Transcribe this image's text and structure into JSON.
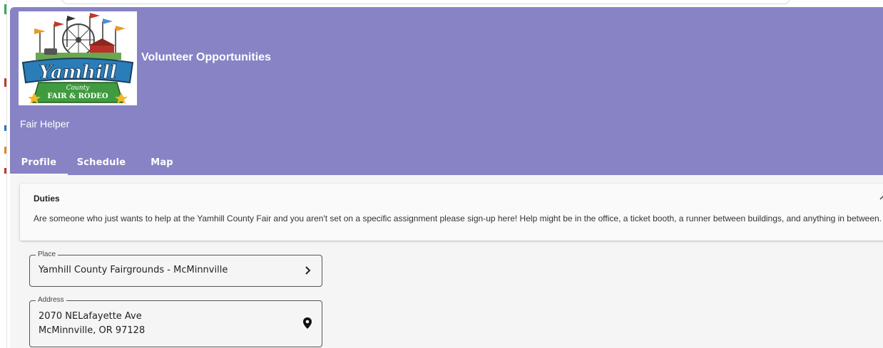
{
  "header": {
    "app_title": "Volunteer Opportunities",
    "role_title": "Fair Helper",
    "logo": {
      "text_main": "Yamhill",
      "text_county": "County",
      "text_sub": "FAIR & RODEO"
    },
    "background_color": "#8783c5"
  },
  "tabs": [
    {
      "label": "Profile",
      "active": true
    },
    {
      "label": "Schedule",
      "active": false
    },
    {
      "label": "Map",
      "active": false
    }
  ],
  "duties": {
    "title": "Duties",
    "text": "Are someone who just wants to help at the Yamhill County Fair and you aren't set on a specific assignment please sign-up here! Help might be in the office, a ticket booth, a runner between buildings, and anything in between."
  },
  "place": {
    "label": "Place",
    "value": "Yamhill County Fairgrounds - McMinnville",
    "icon": "chevron-right-icon"
  },
  "address": {
    "label": "Address",
    "line1": "2070 NELafayette Ave",
    "line2": "McMinnville, OR 97128",
    "icon": "map-pin-icon"
  }
}
